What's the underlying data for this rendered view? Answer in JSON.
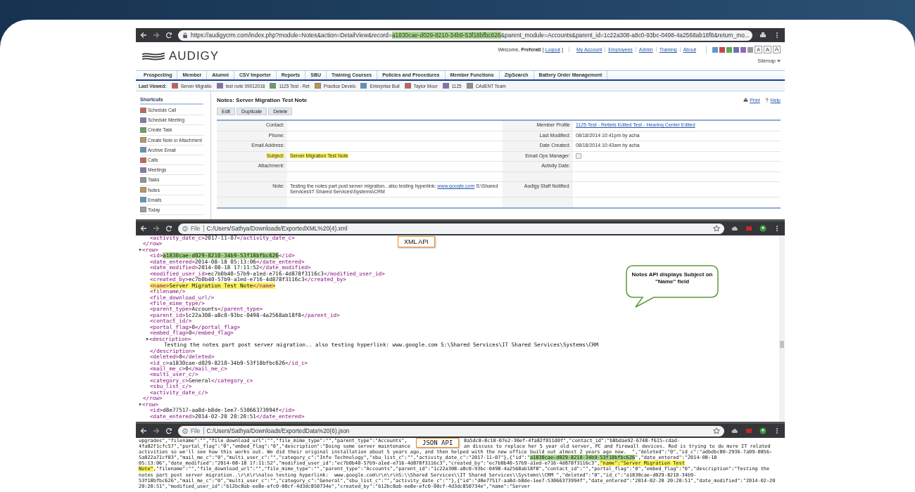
{
  "crm_window": {
    "url": {
      "before": "https://audigycrm.com/index.php?module=Notes&action=DetailView&record=",
      "highlight": "a1830cae-d029-8210-34b9-53f18bfbc626",
      "after": "&parent_module=Accounts&parent_id=1c22a308-a8c0-93bc-0498-4a2568ab18f8&return_mo..."
    },
    "logo": "AUDIGY",
    "welcome": "Welcome, **Preferati** [",
    "logout": "Logout",
    "welcome_end": "]",
    "top_links": [
      "My Account",
      "Employees",
      "Admin",
      "Training",
      "About"
    ],
    "font_size_buttons": [
      "A",
      "A",
      "A"
    ],
    "sitemap": "Sitemap",
    "nav_tabs": [
      "Prospecting",
      "Member",
      "Alumni",
      "CSV Importer",
      "Reports",
      "SBU",
      "Training Courses",
      "Policies and Procedures",
      "Member Functions",
      "ZipSearch",
      "Battery Order Management"
    ],
    "last_viewed_label": "Last Viewed:",
    "last_viewed": [
      "Server Migratio",
      "test note 09012018",
      "1125 Test - Ret",
      "Practice Develo",
      "Enterprise Buil",
      "Taylor Moor",
      "1125",
      "CAdENT Team"
    ],
    "shortcuts_title": "Shortcuts",
    "shortcuts": [
      "Schedule Call",
      "Schedule Meeting",
      "Create Task",
      "Create Note or Attachment",
      "Archive Email",
      "Calls",
      "Meetings",
      "Tasks",
      "Notes",
      "Emails",
      "Today"
    ],
    "title": "Notes: Server Migration Test Note",
    "actions": [
      "Edit",
      "Duplicate",
      "Delete"
    ],
    "print": "Print",
    "help": "Help",
    "rows": [
      {
        "kind": "fields",
        "left": {
          "label": "Contact:"
        },
        "right": {
          "label": "Member Profile",
          "kind": "link",
          "value": "1125 Test - Retlets Edited Test - Hearing Center Edited"
        }
      },
      {
        "kind": "fields",
        "left": {
          "label": "Phone:"
        },
        "right": {
          "label": "Last Modified:",
          "kind": "text",
          "value": "08/18/2014 10:41pm by acha"
        }
      },
      {
        "kind": "fields",
        "left": {
          "label": "Email Address:"
        },
        "right": {
          "label": "Date Created:",
          "kind": "text",
          "value": "08/18/2014 10:43am by acha"
        }
      },
      {
        "kind": "fields",
        "left": {
          "label": "Subject:",
          "kind": "highlight",
          "value": "Server Migration Test Note"
        },
        "right": {
          "label": "Email Ops Manager:",
          "kind": "checkbox",
          "checked": false
        }
      },
      {
        "kind": "fields",
        "left": {
          "label": "Attachment:"
        },
        "right": {
          "label": "Activity Date:"
        }
      },
      {
        "kind": "blank"
      },
      {
        "kind": "fields",
        "left": {
          "label": "Note:",
          "kind": "note",
          "value": "Testing the notes part post server migration.. also testing hyperlink: ",
          "link": "www.google.com",
          "value_after": " S:\\Shared Services\\IT Shared Services\\Systems\\CRM"
        },
        "right": {
          "label": "Audigy Staff Notified:"
        }
      },
      {
        "kind": "blank"
      }
    ]
  },
  "xml_window": {
    "file_label": "File",
    "path": "C:/Users/Sathya/Downloads/ExportedXML%20(4).xml",
    "api_label": "XML API",
    "tree": [
      {
        "children": [
          {
            "text": "<activity_date_c>2017-11-07</activity_date_c>"
          }
        ],
        "close": "</row>"
      },
      {
        "open": "<row>",
        "expanded": true,
        "close": "</row>",
        "children": [
          {
            "parts": [
              {
                "text": "<id>",
                "kind": "plain"
              },
              {
                "text": "a1830cae-d029-8210-34b9-53f18bfbc626",
                "kind": "id"
              },
              {
                "text": "</id>",
                "kind": "plain"
              }
            ]
          },
          {
            "text": "<date_entered>2014-08-18 05:13:06</date_entered>"
          },
          {
            "text": "<date_modified>2014-08-18 17:11:52</date_modified>"
          },
          {
            "text": "<modified_user_id>ec7b0b40-57b9-a1ed-e716-4d878f3116c3</modified_user_id>"
          },
          {
            "text": "<created_by>ec7b0b40-57b9-a1ed-e716-4d878f3116c3</created_by>"
          },
          {
            "parts": [
              {
                "text": "<name>Server Migration Test Note</name>",
                "kind": "name"
              }
            ]
          },
          {
            "text": "<filename/>"
          },
          {
            "text": "<file_download_url/>"
          },
          {
            "text": "<file_mime_type/>"
          },
          {
            "text": "<parent_type>Accounts</parent_type>"
          },
          {
            "text": "<parent_id>1c22a308-a8c0-93bc-0498-4a2568ab18f8</parent_id>"
          },
          {
            "text": "<contact_id/>"
          },
          {
            "text": "<portal_flag>0</portal_flag>"
          },
          {
            "text": "<embed_flag>0</embed_flag>"
          },
          {
            "open": "<description>",
            "expanded": true,
            "close": "</description>",
            "children": [
              {
                "text": "Testing the notes part post server migration.. also testing hyperlink: www.google.com S:\\Shared Services\\IT Shared Services\\Systems\\CRM"
              }
            ]
          },
          {
            "text": "<deleted>0</deleted>"
          },
          {
            "text": "<id_c>a1830cae-d029-8210-34b9-53f18bfbc626</id_c>"
          },
          {
            "text": "<mail_me_c>0</mail_me_c>"
          },
          {
            "text": "<multi_user_c/>"
          },
          {
            "text": "<category_c>General</category_c>"
          },
          {
            "text": "<sbu_list_c/>"
          },
          {
            "text": "<activity_date_c/>"
          }
        ]
      },
      {
        "open": "<row>",
        "expanded": true,
        "children": [
          {
            "text": "<id>d8e77517-aa8d-b8de-1ee7-53066373994f</id>"
          },
          {
            "text": "<date_entered>2014-02-20 20:20:51</date_entered>"
          }
        ]
      }
    ],
    "callout": "Notes API displays Subject on \"Name\" field"
  },
  "json_window": {
    "file_label": "File",
    "path": "C:/Users/Sathya/Downloads/ExportedData%20(6).json",
    "api_label": "JSON API",
    "lines": [
      [
        {
          "text": "upgrades\",\"filename\":\"\",\"file_download_url\":\"\",\"file_mime_type\":\"\",\"parent_type\":\"Accounts\",",
          "kind": "plain"
        },
        {
          "text": "8a5dc8-8c10-07e2-30ef-4fa82f011d0f\",\"contact_id\":\"b8bdae92-6748-f615-cdad-",
          "kind": "after-label"
        }
      ],
      [
        {
          "text": "4fa82f1cfc57\",\"portal_flag\":\"0\",\"embed_flag\":\"0\",\"description\":\"Doing some server maintenance",
          "kind": "plain"
        },
        {
          "text": "an discuss to replace her 5 year old server, PC and firewall devices. Rod is trying to do more IT related",
          "kind": "after-label"
        }
      ],
      [
        {
          "text": "activities so we'll see how this works out. We did their original installation about 5 years ago, and then helped with the new office build out almost 2 years ago now.  \",\"deleted\":\"0\",\"id_c\":\"adbdbc80-2936-7a09-0856-",
          "kind": "plain"
        }
      ],
      [
        {
          "text": "5a022a71cf03\",\"mail_me_c\":\"0\",\"multi_user_c\":\"\",\"category_c\":\"Info Technology\",\"sbu_list_c\":\"\",\"activity_date_c\":\"2017-11-07\"},{\"id\":\"",
          "kind": "plain"
        },
        {
          "text": "a1830cae-d029-8210-34b9-53f18bfbc626",
          "kind": "id"
        },
        {
          "text": "\",\"date_entered\":\"2014-08-18",
          "kind": "plain"
        }
      ],
      [
        {
          "text": "05:13:06\",\"date_modified\":\"2014-08-18 17:11:52\",\"modified_user_id\":\"ec7b0b40-57b9-a1ed-e716-4d878f3116c3\",\"created_by\":\"ec7b0b40-57b9-a1ed-e716-4d878f3116c3\",",
          "kind": "plain"
        },
        {
          "text": "\"name\":\"Server Migration Test",
          "kind": "name"
        }
      ],
      [
        {
          "text": "Note\"",
          "kind": "name"
        },
        {
          "text": ",\"filename\":\"\",\"file_download_url\":\"\",\"file_mime_type\":\"\",\"parent_type\":\"Accounts\",\"parent_id\":\"1c22a308-a8c0-93bc-0498-4a2568ab18f8\",\"contact_id\":\"\",\"portal_flag\":\"0\",\"embed_flag\":\"0\",\"description\":\"Testing the",
          "kind": "plain"
        }
      ],
      [
        {
          "text": "notes part post server migration..\\r\\n\\r\\nalso testing hyperlink:  www.google.com\\r\\n\\r\\nS:\\\\Shared Services\\\\IT Shared Services\\\\Systems\\\\CRM \",\"deleted\":\"0\",\"id_c\":\"a1830cae-d029-8210-34b9-",
          "kind": "plain"
        }
      ],
      [
        {
          "text": "53f18bfbc626\",\"mail_me_c\":\"0\",\"multi_user_c\":\"\",\"category_c\":\"General\",\"sbu_list_c\":\"\",\"activity_date_c\":\"\"},{\"id\":\"d8e77517-aa8d-b8de-1ee7-53066373994f\",\"date_entered\":\"2014-02-20 20:20:51\",\"date_modified\":\"2014-02-20",
          "kind": "plain"
        }
      ],
      [
        {
          "text": "20:20:51\",\"modified_user_id\":\"b12bc8ab-ee8e-efc0-00cf-4d3dc850734e\",\"created_by\":\"b12bc8ab-ee8e-efc0-00cf-4d3dc850734e\",\"name\":\"Server",
          "kind": "plain"
        }
      ]
    ]
  }
}
